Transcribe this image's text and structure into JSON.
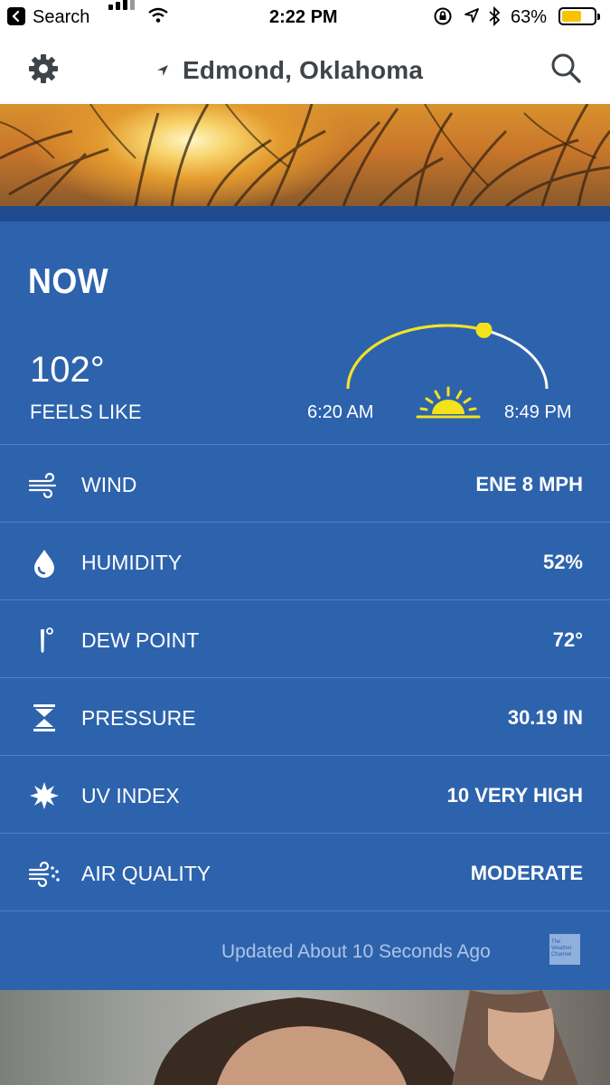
{
  "status_bar": {
    "back_label": "Search",
    "time": "2:22 PM",
    "battery_pct": "63%",
    "battery_level": 0.63
  },
  "header": {
    "location": "Edmond, Oklahoma"
  },
  "now": {
    "title": "NOW",
    "temperature": "102°",
    "feels_like_label": "FEELS LIKE",
    "sunrise": "6:20 AM",
    "sunset": "8:49 PM",
    "sun_progress": 0.62
  },
  "conditions": [
    {
      "icon": "wind-icon",
      "label": "WIND",
      "value": "ENE 8 MPH"
    },
    {
      "icon": "humidity-icon",
      "label": "HUMIDITY",
      "value": "52%"
    },
    {
      "icon": "dew-point-icon",
      "label": "DEW POINT",
      "value": "72°"
    },
    {
      "icon": "pressure-icon",
      "label": "PRESSURE",
      "value": "30.19 IN"
    },
    {
      "icon": "uv-index-icon",
      "label": "UV INDEX",
      "value": "10 VERY HIGH"
    },
    {
      "icon": "air-quality-icon",
      "label": "AIR QUALITY",
      "value": "MODERATE"
    }
  ],
  "footer": {
    "updated": "Updated About 10 Seconds Ago",
    "logo_text": "The Weather Channel"
  },
  "colors": {
    "card": "#2d63ad",
    "band": "#1f4b8e",
    "sun": "#f3e21c",
    "title": "#3f4448"
  }
}
